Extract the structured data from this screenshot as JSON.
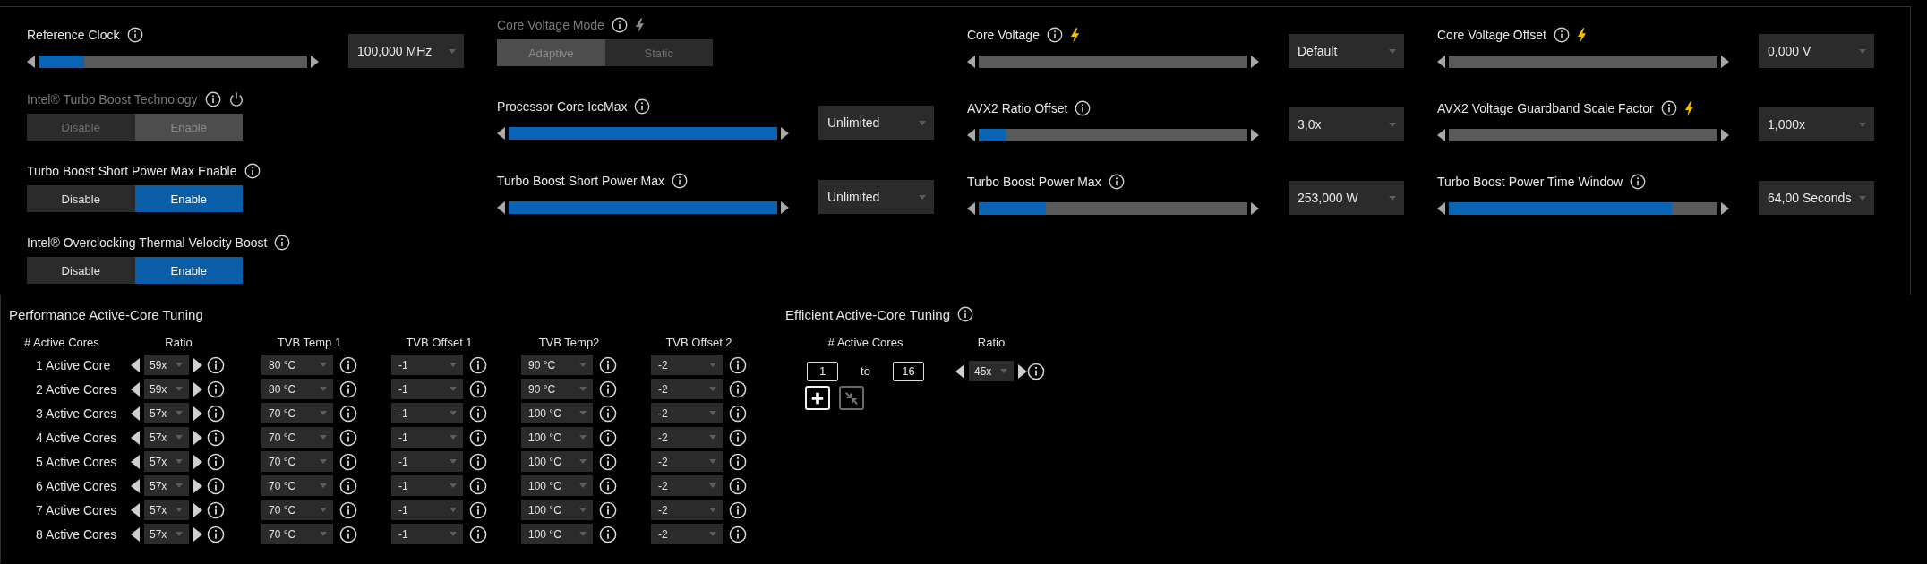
{
  "settings_columns": [
    {
      "items": [
        {
          "kind": "slider",
          "label": "Reference Clock",
          "disabled": false,
          "bolt": false,
          "power": false,
          "level": 0.17,
          "value": "100,000 MHz"
        },
        {
          "kind": "toggle",
          "label": "Intel® Turbo Boost Technology",
          "disabled": true,
          "bolt": false,
          "power": true,
          "options": [
            {
              "label": "Disable",
              "selected": false
            },
            {
              "label": "Enable",
              "selected": true
            }
          ]
        },
        {
          "kind": "toggle",
          "label": "Turbo Boost Short Power Max Enable",
          "disabled": false,
          "bolt": false,
          "power": false,
          "options": [
            {
              "label": "Disable",
              "selected": false
            },
            {
              "label": "Enable",
              "selected": true
            }
          ]
        },
        {
          "kind": "toggle",
          "label": "Intel® Overclocking Thermal Velocity Boost",
          "disabled": false,
          "bolt": false,
          "power": false,
          "options": [
            {
              "label": "Disable",
              "selected": false
            },
            {
              "label": "Enable",
              "selected": true
            }
          ]
        }
      ]
    },
    {
      "items": [
        {
          "kind": "toggle",
          "label": "Core Voltage Mode",
          "disabled": true,
          "bolt": true,
          "power": false,
          "options": [
            {
              "label": "Adaptive",
              "selected": true
            },
            {
              "label": "Static",
              "selected": false
            }
          ]
        },
        {
          "kind": "slider",
          "label": "Processor Core IccMax",
          "disabled": false,
          "bolt": false,
          "power": false,
          "level": 1,
          "value": "Unlimited"
        },
        {
          "kind": "slider",
          "label": "Turbo Boost Short Power Max",
          "disabled": false,
          "bolt": false,
          "power": false,
          "level": 1,
          "value": "Unlimited"
        }
      ]
    },
    {
      "items": [
        {
          "kind": "slider",
          "label": "Core Voltage",
          "disabled": false,
          "bolt": true,
          "power": false,
          "level": 0,
          "value": "Default"
        },
        {
          "kind": "slider",
          "label": "AVX2 Ratio Offset",
          "disabled": false,
          "bolt": false,
          "power": false,
          "level": 0.1,
          "value": "3,0x"
        },
        {
          "kind": "slider",
          "label": "Turbo Boost Power Max",
          "disabled": false,
          "bolt": false,
          "power": false,
          "level": 0.25,
          "value": "253,000 W"
        }
      ]
    },
    {
      "items": [
        {
          "kind": "slider",
          "label": "Core Voltage Offset",
          "disabled": false,
          "bolt": true,
          "power": false,
          "level": 0,
          "value": "0,000 V"
        },
        {
          "kind": "slider",
          "label": "AVX2 Voltage Guardband Scale Factor",
          "disabled": false,
          "bolt": true,
          "power": false,
          "level": 0,
          "value": "1,000x"
        },
        {
          "kind": "slider",
          "label": "Turbo Boost Power Time Window",
          "disabled": false,
          "bolt": false,
          "power": false,
          "level": 0.83,
          "value": "64,00 Seconds"
        }
      ]
    }
  ],
  "performance_tuning": {
    "title": "Performance Active-Core Tuning",
    "columns": [
      "# Active Cores",
      "Ratio",
      "TVB Temp 1",
      "TVB Offset 1",
      "TVB Temp2",
      "TVB Offset 2"
    ],
    "rows": [
      {
        "label": "1 Active Core",
        "ratio": "59x",
        "tvb_temp_1": "80 °C",
        "tvb_offset_1": "-1",
        "tvb_temp_2": "90 °C",
        "tvb_offset_2": "-2"
      },
      {
        "label": "2 Active Cores",
        "ratio": "59x",
        "tvb_temp_1": "80 °C",
        "tvb_offset_1": "-1",
        "tvb_temp_2": "90 °C",
        "tvb_offset_2": "-2"
      },
      {
        "label": "3 Active Cores",
        "ratio": "57x",
        "tvb_temp_1": "70 °C",
        "tvb_offset_1": "-1",
        "tvb_temp_2": "100 °C",
        "tvb_offset_2": "-2"
      },
      {
        "label": "4 Active Cores",
        "ratio": "57x",
        "tvb_temp_1": "70 °C",
        "tvb_offset_1": "-1",
        "tvb_temp_2": "100 °C",
        "tvb_offset_2": "-2"
      },
      {
        "label": "5 Active Cores",
        "ratio": "57x",
        "tvb_temp_1": "70 °C",
        "tvb_offset_1": "-1",
        "tvb_temp_2": "100 °C",
        "tvb_offset_2": "-2"
      },
      {
        "label": "6 Active Cores",
        "ratio": "57x",
        "tvb_temp_1": "70 °C",
        "tvb_offset_1": "-1",
        "tvb_temp_2": "100 °C",
        "tvb_offset_2": "-2"
      },
      {
        "label": "7 Active Cores",
        "ratio": "57x",
        "tvb_temp_1": "70 °C",
        "tvb_offset_1": "-1",
        "tvb_temp_2": "100 °C",
        "tvb_offset_2": "-2"
      },
      {
        "label": "8 Active Cores",
        "ratio": "57x",
        "tvb_temp_1": "70 °C",
        "tvb_offset_1": "-1",
        "tvb_temp_2": "100 °C",
        "tvb_offset_2": "-2"
      }
    ]
  },
  "efficient_tuning": {
    "title": "Efficient Active-Core Tuning",
    "columns": [
      "# Active Cores",
      "Ratio"
    ],
    "range_start": "1",
    "range_word": "to",
    "range_end": "16",
    "ratio": "45x",
    "buttons": [
      {
        "kind": "add",
        "disabled": false
      },
      {
        "kind": "collapse",
        "disabled": true
      }
    ]
  }
}
